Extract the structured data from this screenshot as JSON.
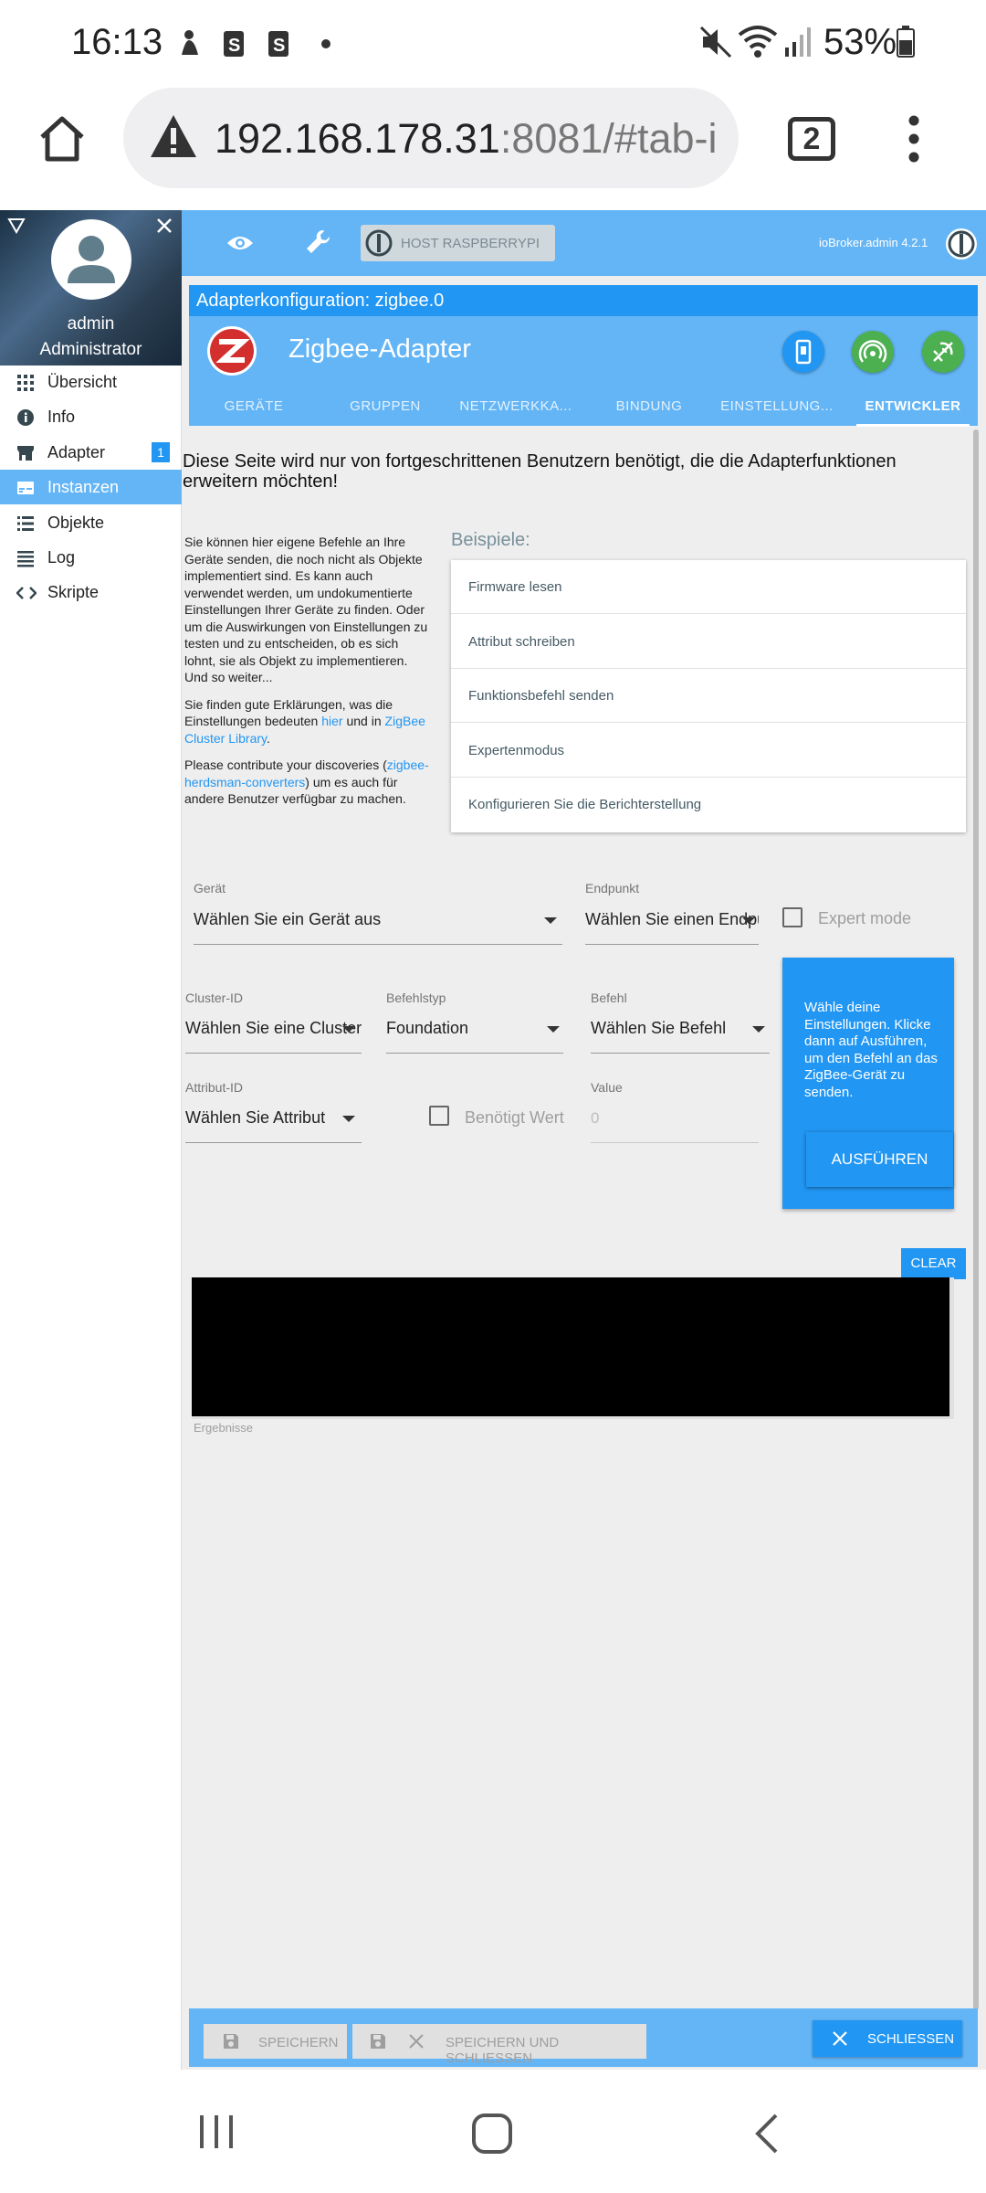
{
  "status_bar": {
    "time": "16:13",
    "battery": "53%"
  },
  "browser": {
    "url_host": "192.168.178.31",
    "url_rest": ":8081/#tab-i",
    "tab_count": "2"
  },
  "sidebar": {
    "user_name": "admin",
    "user_role": "Administrator",
    "items": [
      {
        "label": "Übersicht",
        "icon": "grid-icon"
      },
      {
        "label": "Info",
        "icon": "info-icon"
      },
      {
        "label": "Adapter",
        "icon": "store-icon",
        "badge": "1"
      },
      {
        "label": "Instanzen",
        "icon": "instances-icon",
        "active": true
      },
      {
        "label": "Objekte",
        "icon": "list-icon"
      },
      {
        "label": "Log",
        "icon": "log-icon"
      },
      {
        "label": "Skripte",
        "icon": "code-icon"
      }
    ]
  },
  "topbar": {
    "host_label": "HOST RASPBERRYPI",
    "version": "ioBroker.admin 4.2.1"
  },
  "config": {
    "title": "Adapterkonfiguration: zigbee.0",
    "adapter_name": "Zigbee-Adapter",
    "tabs": [
      "GERÄTE",
      "GRUPPEN",
      "NETZWERKKA...",
      "BINDUNG",
      "EINSTELLUNG...",
      "ENTWICKLER"
    ],
    "active_tab": "ENTWICKLER"
  },
  "developer": {
    "intro": "Diese Seite wird nur von fortgeschrittenen Benutzern benötigt, die die Adapterfunktionen erweitern möchten!",
    "description": "Sie können hier eigene Befehle an Ihre Geräte senden, die noch nicht als Objekte implementiert sind. Es kann auch verwendet werden, um undokumentierte Einstellungen Ihrer Geräte zu finden. Oder um die Auswirkungen von Einstellungen zu testen und zu entscheiden, ob es sich lohnt, sie als Objekt zu implementieren. Und so weiter...",
    "explanations_pre": "Sie finden gute Erklärungen, was die Einstellungen bedeuten",
    "link_hier": "hier",
    "explanations_mid": "und in",
    "link_zcl": "ZigBee Cluster Library",
    "contribute_pre": "Please contribute your discoveries (",
    "link_converters": "zigbee-herdsman-converters",
    "contribute_post": ") um es auch für andere Benutzer verfügbar zu machen.",
    "examples_title": "Beispiele:",
    "examples": [
      "Firmware lesen",
      "Attribut schreiben",
      "Funktionsbefehl senden",
      "Expertenmodus",
      "Konfigurieren Sie die Berichterstellung"
    ],
    "device": {
      "label": "Gerät",
      "value": "Wählen Sie ein Gerät aus"
    },
    "endpoint": {
      "label": "Endpunkt",
      "value": "Wählen Sie einen Endpunkt"
    },
    "expert_mode": "Expert mode",
    "cluster": {
      "label": "Cluster-ID",
      "value": "Wählen Sie eine Cluster-ID"
    },
    "command_type": {
      "label": "Befehlstyp",
      "value": "Foundation"
    },
    "command": {
      "label": "Befehl",
      "value": "Wählen Sie Befehl"
    },
    "attribute": {
      "label": "Attribut-ID",
      "value": "Wählen Sie Attribut"
    },
    "needs_value": "Benötigt Wert",
    "value": {
      "label": "Value",
      "placeholder": "0"
    },
    "info_text": "Wähle deine Einstellungen. Klicke dann auf Ausführen, um den Befehl an das ZigBee-Gerät zu senden.",
    "run_label": "AUSFÜHREN",
    "clear_label": "CLEAR",
    "results_label": "Ergebnisse"
  },
  "footer": {
    "save": "SPEICHERN",
    "save_close": "SPEICHERN UND SCHLIESSEN",
    "close": "SCHLIESSEN"
  },
  "colors": {
    "primary": "#2196f3",
    "light": "#64b5f6",
    "zigbee_red": "#d32f2f",
    "green": "#4caf50"
  }
}
